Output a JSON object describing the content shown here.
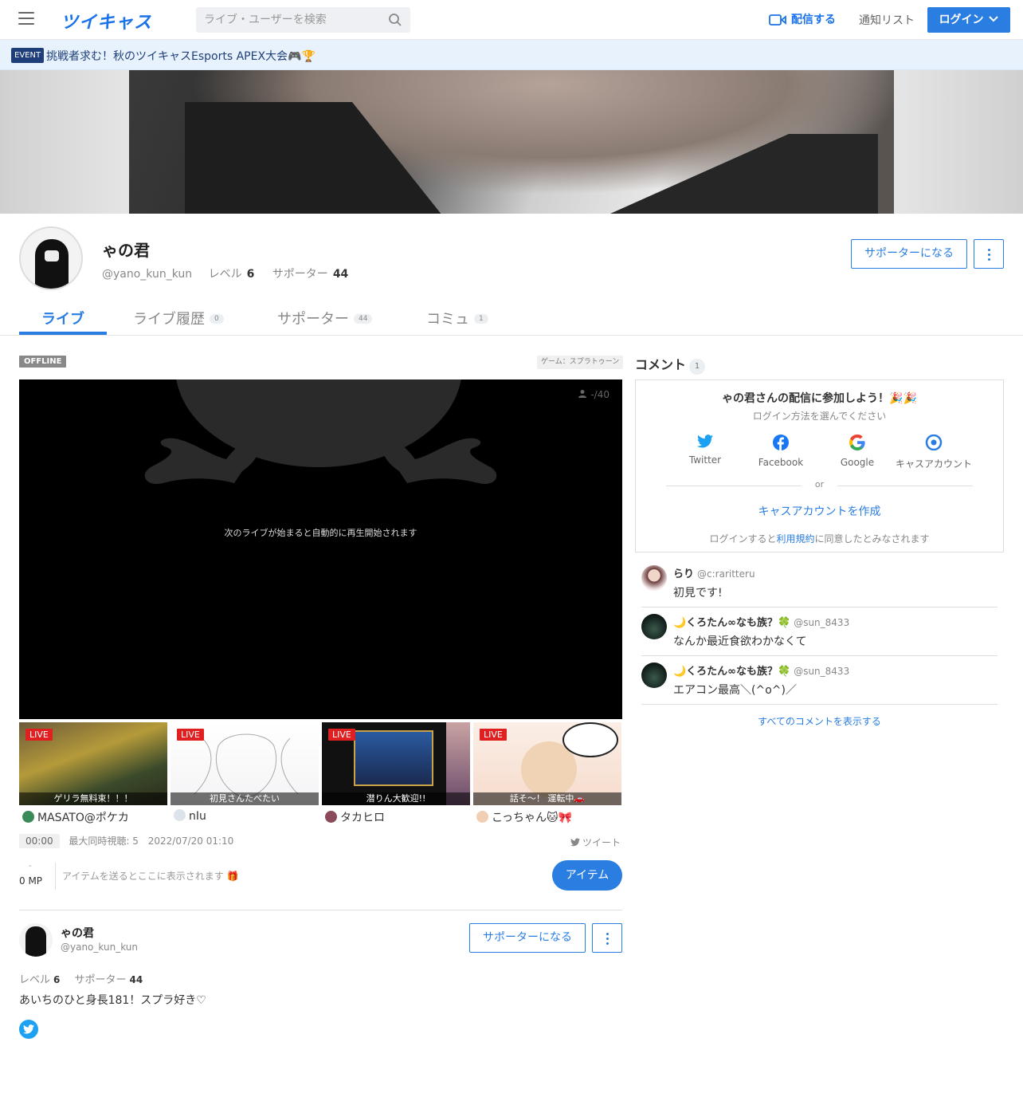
{
  "header": {
    "logo": "ツイキャス",
    "search_placeholder": "ライブ・ユーザーを検索",
    "broadcast_label": "配信する",
    "notify_label": "通知リスト",
    "login_label": "ログイン"
  },
  "event": {
    "badge": "EVENT",
    "text": "挑戦者求む！秋のツイキャスEsports APEX大会🎮🏆"
  },
  "profile": {
    "name": "ゃの君",
    "handle": "@yano_kun_kun",
    "level_label": "レベル",
    "level": "6",
    "supporter_label": "サポーター",
    "supporters": "44",
    "supporter_button": "サポーターになる"
  },
  "tabs": [
    {
      "label": "ライブ",
      "count": ""
    },
    {
      "label": "ライブ履歴",
      "count": "0"
    },
    {
      "label": "サポーター",
      "count": "44"
    },
    {
      "label": "コミュ",
      "count": "1"
    }
  ],
  "player": {
    "status": "OFFLINE",
    "game_tag": "ゲーム：スプラトゥーン",
    "viewers": "-/40",
    "message": "次のライブが始まると自動的に再生開始されます"
  },
  "thumbnails": [
    {
      "live": "LIVE",
      "caption": "ゲリラ無料束！！！",
      "user": "MASATO@ポケカ"
    },
    {
      "live": "LIVE",
      "caption": "初見さんたべたい",
      "user": "nIu"
    },
    {
      "live": "LIVE",
      "caption": "潜りん大歓迎!!",
      "user": "タカヒロ"
    },
    {
      "live": "LIVE",
      "caption": "話そ〜！ 運転中🚗",
      "user": "こっちゃん🐱🎀"
    }
  ],
  "stats": {
    "time": "00:00",
    "max_viewers": "最大同時視聴: 5",
    "date": "2022/07/20 01:10",
    "tweet": "ツイート"
  },
  "items": {
    "mp_top": "-",
    "mp": "0 MP",
    "hint": "アイテムを送るとここに表示されます 🎁",
    "button": "アイテム"
  },
  "comments": {
    "title": "コメント",
    "count": "1",
    "join_title": "ゃの君さんの配信に参加しよう！🎉🎉",
    "join_sub": "ログイン方法を選んでください",
    "sns": [
      "Twitter",
      "Facebook",
      "Google",
      "キャスアカウント"
    ],
    "or": "or",
    "create": "キャスアカウントを作成",
    "terms_pre": "ログインすると",
    "terms_link": "利用規約",
    "terms_post": "に同意したとみなされます",
    "list": [
      {
        "name": "らり",
        "handle": "@c:raritteru",
        "text": "初見です!"
      },
      {
        "name": "🌙くろたん∞なも族？🍀",
        "handle": "@sun_8433",
        "text": "なんか最近食欲わかなくて"
      },
      {
        "name": "🌙くろたん∞なも族？🍀",
        "handle": "@sun_8433",
        "text": "エアコン最高＼(^o^)／"
      }
    ],
    "show_all": "すべてのコメントを表示する"
  },
  "bio": "あいちのひと身長181！スプラ好き♡",
  "colors": {
    "accent": "#2a7de1",
    "live": "#e02020",
    "twitter": "#1da1f2"
  }
}
